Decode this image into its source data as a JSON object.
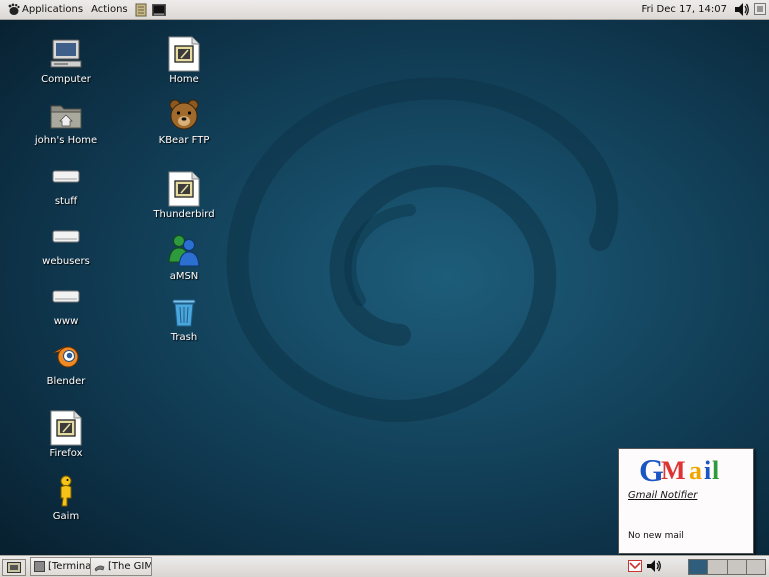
{
  "top_panel": {
    "applications_label": "Applications",
    "actions_label": "Actions",
    "launchers": [
      {
        "icon": "notes-icon"
      },
      {
        "icon": "terminal-icon"
      }
    ],
    "clock": "Fri Dec 17, 14:07",
    "volume_icon": "speaker-icon"
  },
  "desktop": {
    "icons": [
      {
        "label": "Computer",
        "icon": "computer-icon"
      },
      {
        "label": "john's Home",
        "icon": "home-folder-icon"
      },
      {
        "label": "stuff",
        "icon": "drive-icon"
      },
      {
        "label": "webusers",
        "icon": "drive-icon"
      },
      {
        "label": "www",
        "icon": "drive-icon"
      },
      {
        "label": "Blender",
        "icon": "blender-icon"
      },
      {
        "label": "Firefox",
        "icon": "launcher-file-icon"
      },
      {
        "label": "Gaim",
        "icon": "gaim-icon"
      },
      {
        "label": "Home",
        "icon": "launcher-file-icon"
      },
      {
        "label": "KBear FTP",
        "icon": "bear-icon"
      },
      {
        "label": "Thunderbird",
        "icon": "launcher-file-icon"
      },
      {
        "label": "aMSN",
        "icon": "msn-buddies-icon"
      },
      {
        "label": "Trash",
        "icon": "trash-icon"
      }
    ]
  },
  "gmail_popup": {
    "logo_text": "Gmail",
    "title": "Gmail Notifier",
    "status": "No new mail"
  },
  "bottom_panel": {
    "tasks": [
      {
        "label": "[Terminal]"
      },
      {
        "label": "[The GIMP]"
      }
    ],
    "workspaces": 4,
    "active_workspace": 1
  },
  "colors": {
    "desktop_bg": "#174d68",
    "panel_bg": "#e6e3df",
    "gmail_blue": "#1a55c4",
    "gmail_red": "#d33",
    "workspace_active": "#2f5d7c"
  }
}
